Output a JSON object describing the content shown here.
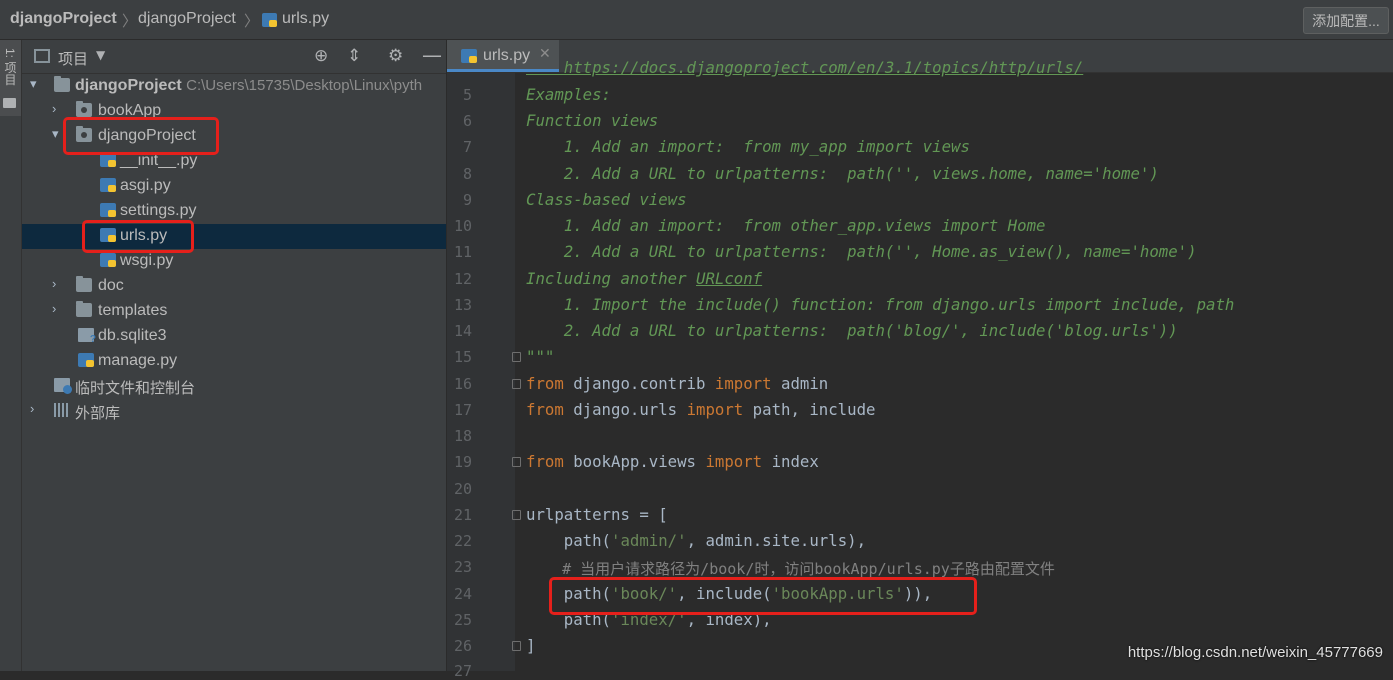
{
  "breadcrumbs": {
    "root": "djangoProject",
    "folder": "djangoProject",
    "file": "urls.py"
  },
  "add_config_label": "添加配置...",
  "tool_strip_label": "1: 项目",
  "project_panel": {
    "title": "项目",
    "tree": {
      "root_label": "djangoProject",
      "root_path": "C:\\Users\\15735\\Desktop\\Linux\\pyth",
      "bookapp": "bookApp",
      "djangoproject": "djangoProject",
      "init": "__init__.py",
      "asgi": "asgi.py",
      "settings": "settings.py",
      "urls": "urls.py",
      "wsgi": "wsgi.py",
      "doc": "doc",
      "templates": "templates",
      "db": "db.sqlite3",
      "manage": "manage.py",
      "scratches": "临时文件和控制台",
      "external_libs": "外部库"
    }
  },
  "editor": {
    "tab_label": "urls.py",
    "line_numbers": [
      "5",
      "6",
      "7",
      "8",
      "9",
      "10",
      "11",
      "12",
      "13",
      "14",
      "15",
      "16",
      "17",
      "18",
      "19",
      "20",
      "21",
      "22",
      "23",
      "24",
      "25",
      "26",
      "27"
    ],
    "lines": {
      "l4": "    https://docs.djangoproject.com/en/3.1/topics/http/urls/",
      "l5": "Examples:",
      "l6": "Function views",
      "l7": "    1. Add an import:  from my_app import views",
      "l8": "    2. Add a URL to urlpatterns:  path('', views.home, name='home')",
      "l9": "Class-based views",
      "l10": "    1. Add an import:  from other_app.views import Home",
      "l11": "    2. Add a URL to urlpatterns:  path('', Home.as_view(), name='home')",
      "l12a": "Including another ",
      "l12b": "URLconf",
      "l13": "    1. Import the include() function: from django.urls import include, path",
      "l14": "    2. Add a URL to urlpatterns:  path('blog/', include('blog.urls'))",
      "l15": "\"\"\"",
      "l16a": "from",
      "l16b": " django.contrib ",
      "l16c": "import",
      "l16d": " admin",
      "l17a": "from",
      "l17b": " django.urls ",
      "l17c": "import",
      "l17d": " path, include",
      "l19a": "from",
      "l19b": " bookApp.views ",
      "l19c": "import",
      "l19d": " index",
      "l21": "urlpatterns = [",
      "l22a": "    path(",
      "l22b": "'admin/'",
      "l22c": ", admin.site.urls),",
      "l23": "    # 当用户请求路径为/book/时，访问bookApp/urls.py子路由配置文件",
      "l24a": "    path(",
      "l24b": "'book/'",
      "l24c": ", include(",
      "l24d": "'bookApp.urls'",
      "l24e": ")),",
      "l25a": "    path(",
      "l25b": "'index/'",
      "l25c": ", index),",
      "l26": "]"
    }
  },
  "watermark": "https://blog.csdn.net/weixin_45777669",
  "colors": {
    "highlight_box": "#e5201b",
    "selection": "#0d293e",
    "keyword": "#cc7832",
    "string": "#6a8759",
    "docstring": "#629755"
  }
}
